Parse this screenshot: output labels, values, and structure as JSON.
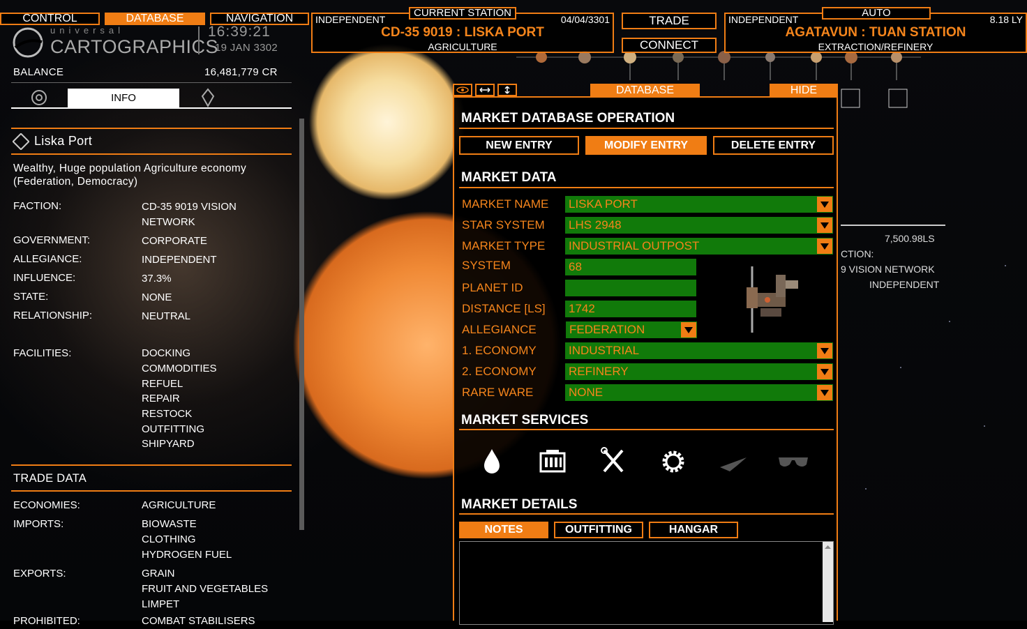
{
  "top_tabs": {
    "control": "CONTROL",
    "database": "DATABASE",
    "navigation": "NAVIGATION"
  },
  "clock": {
    "time": "16:39:21",
    "date": "19 JAN 3302"
  },
  "brand": {
    "line1": "universal",
    "line2": "CARTOGRAPHICS"
  },
  "current_station": {
    "label": "CURRENT STATION",
    "allegiance": "INDEPENDENT",
    "date": "04/04/3301",
    "name": "CD-35 9019 : LISKA PORT",
    "economy": "AGRICULTURE"
  },
  "actions": {
    "trade": "TRADE",
    "connect": "CONNECT"
  },
  "target_station": {
    "label": "AUTO",
    "allegiance": "INDEPENDENT",
    "distance": "8.18 LY",
    "name": "AGATAVUN : TUAN STATION",
    "economy": "EXTRACTION/REFINERY"
  },
  "left": {
    "balance_label": "BALANCE",
    "balance_value": "16,481,779 CR",
    "info_tab": "INFO",
    "station_name": "Liska Port",
    "description": "Wealthy, Huge population Agriculture economy (Federation, Democracy)",
    "rows": [
      {
        "key": "FACTION:",
        "value": "CD-35 9019 VISION NETWORK"
      },
      {
        "key": "GOVERNMENT:",
        "value": "CORPORATE"
      },
      {
        "key": "ALLEGIANCE:",
        "value": "INDEPENDENT"
      },
      {
        "key": "INFLUENCE:",
        "value": "37.3%"
      },
      {
        "key": "STATE:",
        "value": "NONE"
      },
      {
        "key": "RELATIONSHIP:",
        "value": "NEUTRAL"
      }
    ],
    "facilities_label": "FACILITIES:",
    "facilities": [
      "DOCKING",
      "COMMODITIES",
      "REFUEL",
      "REPAIR",
      "RESTOCK",
      "OUTFITTING",
      "SHIPYARD"
    ],
    "trade_data_title": "TRADE DATA",
    "economies_label": "ECONOMIES:",
    "economies": [
      "AGRICULTURE"
    ],
    "imports_label": "IMPORTS:",
    "imports": [
      "BIOWASTE",
      "CLOTHING",
      "HYDROGEN FUEL"
    ],
    "exports_label": "EXPORTS:",
    "exports": [
      "GRAIN",
      "FRUIT AND VEGETABLES",
      "LIMPET"
    ],
    "prohibited_label": "PROHIBITED:",
    "prohibited": [
      "COMBAT STABILISERS"
    ]
  },
  "bg_panel": {
    "distance": "7,500.98LS",
    "faction_label": "CTION:",
    "faction_value": "9 VISION NETWORK",
    "allegiance_value": "INDEPENDENT"
  },
  "db_window": {
    "tab_database": "DATABASE",
    "tab_hide": "HIDE",
    "title": "MARKET DATABASE OPERATION",
    "buttons": {
      "new": "NEW ENTRY",
      "modify": "MODIFY ENTRY",
      "delete": "DELETE ENTRY"
    },
    "market_data_title": "MARKET DATA",
    "fields": {
      "market_name": {
        "label": "MARKET NAME",
        "value": "LISKA PORT"
      },
      "star_system": {
        "label": "STAR SYSTEM",
        "value": "LHS 2948"
      },
      "market_type": {
        "label": "MARKET TYPE",
        "value": "INDUSTRIAL OUTPOST"
      },
      "system": {
        "label": "SYSTEM",
        "value": "68"
      },
      "planet_id": {
        "label": "PLANET ID",
        "value": ""
      },
      "distance": {
        "label": "DISTANCE [LS]",
        "value": "1742"
      },
      "allegiance": {
        "label": "ALLEGIANCE",
        "value": "FEDERATION"
      },
      "economy1": {
        "label": "1. ECONOMY",
        "value": "INDUSTRIAL"
      },
      "economy2": {
        "label": "2. ECONOMY",
        "value": "REFINERY"
      },
      "rare_ware": {
        "label": "RARE WARE",
        "value": "NONE"
      }
    },
    "services_title": "MARKET SERVICES",
    "services": [
      {
        "icon": "refuel-drop-icon",
        "active": true
      },
      {
        "icon": "commodities-crate-icon",
        "active": true
      },
      {
        "icon": "repair-tools-icon",
        "active": true
      },
      {
        "icon": "outfitting-gear-icon",
        "active": true
      },
      {
        "icon": "shipyard-ship-icon",
        "active": false
      },
      {
        "icon": "black-market-glasses-icon",
        "active": false
      }
    ],
    "details_title": "MARKET DETAILS",
    "detail_tabs": {
      "notes": "NOTES",
      "outfitting": "OUTFITTING",
      "hangar": "HANGAR"
    },
    "notes_text": ""
  },
  "colors": {
    "accent": "#f07d14",
    "field_bg": "#117a0a",
    "field_text": "#f5851c"
  }
}
